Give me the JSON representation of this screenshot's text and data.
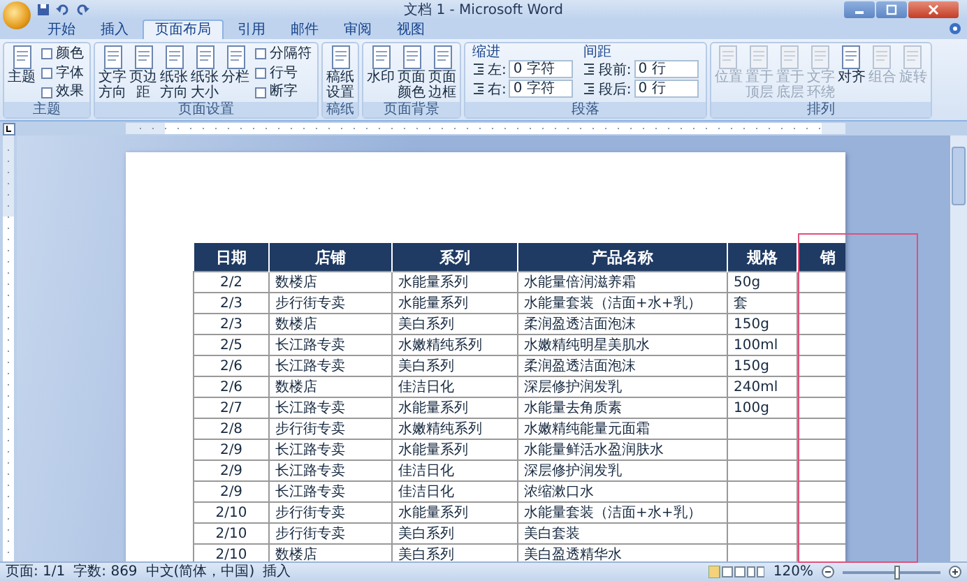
{
  "window": {
    "title": "文档 1 - Microsoft Word"
  },
  "tabs": [
    {
      "label": "开始",
      "selected": false
    },
    {
      "label": "插入",
      "selected": false
    },
    {
      "label": "页面布局",
      "selected": true
    },
    {
      "label": "引用",
      "selected": false
    },
    {
      "label": "邮件",
      "selected": false
    },
    {
      "label": "审阅",
      "selected": false
    },
    {
      "label": "视图",
      "selected": false
    }
  ],
  "ribbon": {
    "groups": [
      {
        "label": "主题",
        "kind": "buttons",
        "items": [
          {
            "label": "主题",
            "kind": "large",
            "disabled": false
          },
          {
            "label": "颜色",
            "kind": "small",
            "disabled": false
          },
          {
            "label": "字体",
            "kind": "small",
            "disabled": false
          },
          {
            "label": "效果",
            "kind": "small",
            "disabled": false
          }
        ]
      },
      {
        "label": "页面设置",
        "kind": "buttons",
        "items": [
          {
            "label": "文字方向",
            "kind": "large",
            "disabled": false
          },
          {
            "label": "页边距",
            "kind": "large",
            "disabled": false
          },
          {
            "label": "纸张方向",
            "kind": "large",
            "disabled": false
          },
          {
            "label": "纸张大小",
            "kind": "large",
            "disabled": false
          },
          {
            "label": "分栏",
            "kind": "large",
            "disabled": false
          },
          {
            "label": "分隔符",
            "kind": "small",
            "disabled": false
          },
          {
            "label": "行号",
            "kind": "small",
            "disabled": false
          },
          {
            "label": "断字",
            "kind": "small",
            "disabled": false
          }
        ]
      },
      {
        "label": "稿纸",
        "kind": "buttons",
        "items": [
          {
            "label": "稿纸设置",
            "kind": "large",
            "disabled": false
          }
        ]
      },
      {
        "label": "页面背景",
        "kind": "buttons",
        "items": [
          {
            "label": "水印",
            "kind": "large",
            "disabled": false
          },
          {
            "label": "页面颜色",
            "kind": "large",
            "disabled": false
          },
          {
            "label": "页面边框",
            "kind": "large",
            "disabled": false
          }
        ]
      },
      {
        "label": "段落",
        "kind": "paragraph",
        "columns": [
          {
            "heading": "缩进",
            "fields": [
              {
                "label": "左:",
                "value": "0 字符"
              },
              {
                "label": "右:",
                "value": "0 字符"
              }
            ]
          },
          {
            "heading": "间距",
            "fields": [
              {
                "label": "段前:",
                "value": "0 行"
              },
              {
                "label": "段后:",
                "value": "0 行"
              }
            ]
          }
        ]
      },
      {
        "label": "排列",
        "kind": "buttons",
        "items": [
          {
            "label": "位置",
            "kind": "large",
            "disabled": true
          },
          {
            "label": "置于顶层",
            "kind": "large",
            "disabled": true
          },
          {
            "label": "置于底层",
            "kind": "large",
            "disabled": true
          },
          {
            "label": "文字环绕",
            "kind": "large",
            "disabled": true
          },
          {
            "label": "对齐",
            "kind": "large",
            "disabled": false
          },
          {
            "label": "组合",
            "kind": "large",
            "disabled": true
          },
          {
            "label": "旋转",
            "kind": "large",
            "disabled": true
          }
        ]
      }
    ]
  },
  "table": {
    "columns": [
      "日期",
      "店铺",
      "系列",
      "产品名称",
      "规格",
      "销"
    ],
    "rows": [
      [
        "2/2",
        "数楼店",
        "水能量系列",
        "水能量倍润滋养霜",
        "50g",
        ""
      ],
      [
        "2/3",
        "步行街专卖",
        "水能量系列",
        "水能量套装（洁面+水+乳）",
        "套",
        ""
      ],
      [
        "2/3",
        "数楼店",
        "美白系列",
        "柔润盈透洁面泡沫",
        "150g",
        ""
      ],
      [
        "2/5",
        "长江路专卖",
        "水嫩精纯系列",
        "水嫩精纯明星美肌水",
        "100ml",
        ""
      ],
      [
        "2/6",
        "长江路专卖",
        "美白系列",
        "柔润盈透洁面泡沫",
        "150g",
        ""
      ],
      [
        "2/6",
        "数楼店",
        "佳洁日化",
        "深层修护润发乳",
        "240ml",
        ""
      ],
      [
        "2/7",
        "长江路专卖",
        "水能量系列",
        "水能量去角质素",
        "100g",
        ""
      ],
      [
        "2/8",
        "步行街专卖",
        "水嫩精纯系列",
        "水嫩精纯能量元面霜",
        "",
        ""
      ],
      [
        "2/9",
        "长江路专卖",
        "水能量系列",
        "水能量鲜活水盈润肤水",
        "",
        ""
      ],
      [
        "2/9",
        "长江路专卖",
        "佳洁日化",
        "深层修护润发乳",
        "",
        ""
      ],
      [
        "2/9",
        "长江路专卖",
        "佳洁日化",
        "浓缩漱口水",
        "",
        ""
      ],
      [
        "2/10",
        "步行街专卖",
        "水能量系列",
        "水能量套装（洁面+水+乳）",
        "",
        ""
      ],
      [
        "2/10",
        "步行街专卖",
        "美白系列",
        "美白套装",
        "",
        ""
      ],
      [
        "2/10",
        "数楼店",
        "美白系列",
        "美白盈透精华水",
        "",
        ""
      ]
    ]
  },
  "status_bar": {
    "items": [
      "页面: 1/1",
      "字数: 869",
      "中文(简体，中国)",
      "插入"
    ],
    "zoom": {
      "label": "120%",
      "level": 0.55
    }
  }
}
